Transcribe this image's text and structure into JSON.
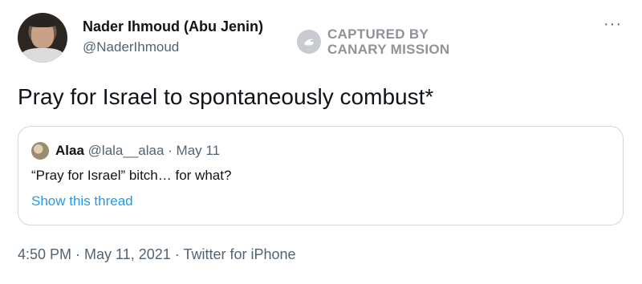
{
  "author": {
    "display_name": "Nader Ihmoud (Abu Jenin)",
    "handle": "@NaderIhmoud"
  },
  "watermark": {
    "line1": "CAPTURED BY",
    "line2": "CANARY MISSION"
  },
  "more_icon_glyph": "···",
  "tweet": {
    "text": "Pray for Israel to spontaneously combust*"
  },
  "quoted_tweet": {
    "name": "Alaa",
    "handle": "@lala__alaa",
    "separator": " · ",
    "date": "May 11",
    "text": "“Pray for Israel” bitch… for what?",
    "show_thread": "Show this thread"
  },
  "footer": {
    "time": "4:50 PM",
    "date": "May 11, 2021",
    "source": "Twitter for iPhone",
    "separator": " · "
  },
  "colors": {
    "text_primary": "#0f1419",
    "text_secondary": "#536471",
    "link": "#1d9bf0",
    "border": "#cfd9de"
  }
}
